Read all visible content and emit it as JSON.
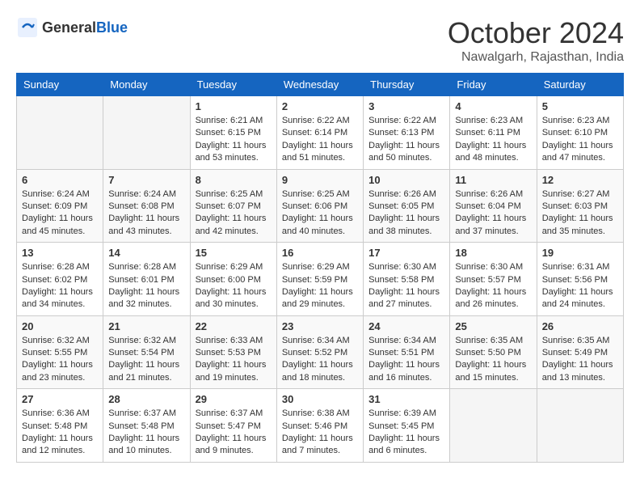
{
  "header": {
    "logo_general": "General",
    "logo_blue": "Blue",
    "month_title": "October 2024",
    "location": "Nawalgarh, Rajasthan, India"
  },
  "calendar": {
    "days_of_week": [
      "Sunday",
      "Monday",
      "Tuesday",
      "Wednesday",
      "Thursday",
      "Friday",
      "Saturday"
    ],
    "weeks": [
      [
        {
          "day": "",
          "empty": true
        },
        {
          "day": "",
          "empty": true
        },
        {
          "day": "1",
          "sunrise": "6:21 AM",
          "sunset": "6:15 PM",
          "daylight": "11 hours and 53 minutes."
        },
        {
          "day": "2",
          "sunrise": "6:22 AM",
          "sunset": "6:14 PM",
          "daylight": "11 hours and 51 minutes."
        },
        {
          "day": "3",
          "sunrise": "6:22 AM",
          "sunset": "6:13 PM",
          "daylight": "11 hours and 50 minutes."
        },
        {
          "day": "4",
          "sunrise": "6:23 AM",
          "sunset": "6:11 PM",
          "daylight": "11 hours and 48 minutes."
        },
        {
          "day": "5",
          "sunrise": "6:23 AM",
          "sunset": "6:10 PM",
          "daylight": "11 hours and 47 minutes."
        }
      ],
      [
        {
          "day": "6",
          "sunrise": "6:24 AM",
          "sunset": "6:09 PM",
          "daylight": "11 hours and 45 minutes."
        },
        {
          "day": "7",
          "sunrise": "6:24 AM",
          "sunset": "6:08 PM",
          "daylight": "11 hours and 43 minutes."
        },
        {
          "day": "8",
          "sunrise": "6:25 AM",
          "sunset": "6:07 PM",
          "daylight": "11 hours and 42 minutes."
        },
        {
          "day": "9",
          "sunrise": "6:25 AM",
          "sunset": "6:06 PM",
          "daylight": "11 hours and 40 minutes."
        },
        {
          "day": "10",
          "sunrise": "6:26 AM",
          "sunset": "6:05 PM",
          "daylight": "11 hours and 38 minutes."
        },
        {
          "day": "11",
          "sunrise": "6:26 AM",
          "sunset": "6:04 PM",
          "daylight": "11 hours and 37 minutes."
        },
        {
          "day": "12",
          "sunrise": "6:27 AM",
          "sunset": "6:03 PM",
          "daylight": "11 hours and 35 minutes."
        }
      ],
      [
        {
          "day": "13",
          "sunrise": "6:28 AM",
          "sunset": "6:02 PM",
          "daylight": "11 hours and 34 minutes."
        },
        {
          "day": "14",
          "sunrise": "6:28 AM",
          "sunset": "6:01 PM",
          "daylight": "11 hours and 32 minutes."
        },
        {
          "day": "15",
          "sunrise": "6:29 AM",
          "sunset": "6:00 PM",
          "daylight": "11 hours and 30 minutes."
        },
        {
          "day": "16",
          "sunrise": "6:29 AM",
          "sunset": "5:59 PM",
          "daylight": "11 hours and 29 minutes."
        },
        {
          "day": "17",
          "sunrise": "6:30 AM",
          "sunset": "5:58 PM",
          "daylight": "11 hours and 27 minutes."
        },
        {
          "day": "18",
          "sunrise": "6:30 AM",
          "sunset": "5:57 PM",
          "daylight": "11 hours and 26 minutes."
        },
        {
          "day": "19",
          "sunrise": "6:31 AM",
          "sunset": "5:56 PM",
          "daylight": "11 hours and 24 minutes."
        }
      ],
      [
        {
          "day": "20",
          "sunrise": "6:32 AM",
          "sunset": "5:55 PM",
          "daylight": "11 hours and 23 minutes."
        },
        {
          "day": "21",
          "sunrise": "6:32 AM",
          "sunset": "5:54 PM",
          "daylight": "11 hours and 21 minutes."
        },
        {
          "day": "22",
          "sunrise": "6:33 AM",
          "sunset": "5:53 PM",
          "daylight": "11 hours and 19 minutes."
        },
        {
          "day": "23",
          "sunrise": "6:34 AM",
          "sunset": "5:52 PM",
          "daylight": "11 hours and 18 minutes."
        },
        {
          "day": "24",
          "sunrise": "6:34 AM",
          "sunset": "5:51 PM",
          "daylight": "11 hours and 16 minutes."
        },
        {
          "day": "25",
          "sunrise": "6:35 AM",
          "sunset": "5:50 PM",
          "daylight": "11 hours and 15 minutes."
        },
        {
          "day": "26",
          "sunrise": "6:35 AM",
          "sunset": "5:49 PM",
          "daylight": "11 hours and 13 minutes."
        }
      ],
      [
        {
          "day": "27",
          "sunrise": "6:36 AM",
          "sunset": "5:48 PM",
          "daylight": "11 hours and 12 minutes."
        },
        {
          "day": "28",
          "sunrise": "6:37 AM",
          "sunset": "5:48 PM",
          "daylight": "11 hours and 10 minutes."
        },
        {
          "day": "29",
          "sunrise": "6:37 AM",
          "sunset": "5:47 PM",
          "daylight": "11 hours and 9 minutes."
        },
        {
          "day": "30",
          "sunrise": "6:38 AM",
          "sunset": "5:46 PM",
          "daylight": "11 hours and 7 minutes."
        },
        {
          "day": "31",
          "sunrise": "6:39 AM",
          "sunset": "5:45 PM",
          "daylight": "11 hours and 6 minutes."
        },
        {
          "day": "",
          "empty": true
        },
        {
          "day": "",
          "empty": true
        }
      ]
    ]
  }
}
